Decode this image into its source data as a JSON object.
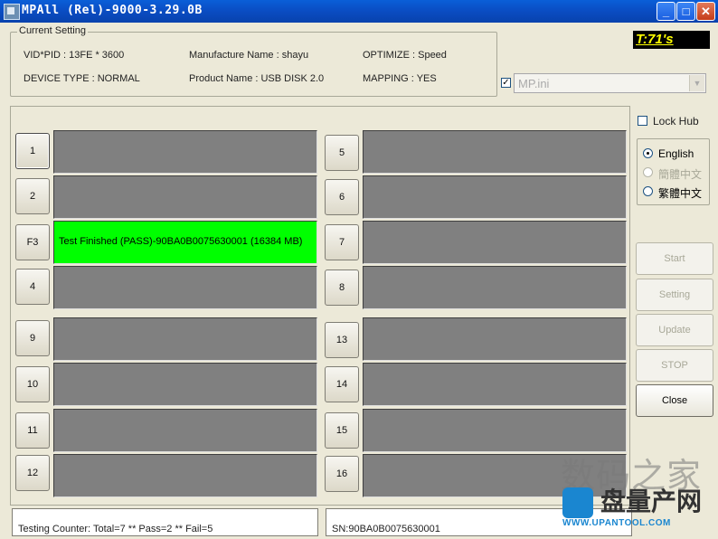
{
  "window": {
    "title": "MPAll (Rel)-9000-3.29.0B",
    "min_glyph": "_",
    "max_glyph": "□",
    "close_glyph": "✕"
  },
  "current_setting": {
    "legend": "Current Setting",
    "vid_pid": "VID*PID : 13FE * 3600",
    "device_type": "DEVICE TYPE : NORMAL",
    "manufacture_name": "Manufacture Name : shayu",
    "product_name": "Product Name : USB DISK 2.0",
    "optimize": "OPTIMIZE : Speed",
    "mapping": "MAPPING : YES"
  },
  "timer": "T:71's",
  "ini": {
    "checked_glyph": "✓",
    "value": "MP.ini",
    "arrow": "▼"
  },
  "lock_hub": {
    "label": "Lock Hub"
  },
  "language": {
    "options": [
      {
        "label": "English",
        "selected": true,
        "enabled": true
      },
      {
        "label": "簡體中文",
        "selected": false,
        "enabled": false
      },
      {
        "label": "繁體中文",
        "selected": false,
        "enabled": true
      }
    ]
  },
  "ports": [
    {
      "label": "1",
      "status": ""
    },
    {
      "label": "2",
      "status": ""
    },
    {
      "label": "F3",
      "status": "Test Finished (PASS)-90BA0B0075630001 (16384 MB)"
    },
    {
      "label": "4",
      "status": ""
    },
    {
      "label": "5",
      "status": ""
    },
    {
      "label": "6",
      "status": ""
    },
    {
      "label": "7",
      "status": ""
    },
    {
      "label": "8",
      "status": ""
    },
    {
      "label": "9",
      "status": ""
    },
    {
      "label": "10",
      "status": ""
    },
    {
      "label": "11",
      "status": ""
    },
    {
      "label": "12",
      "status": ""
    },
    {
      "label": "13",
      "status": ""
    },
    {
      "label": "14",
      "status": ""
    },
    {
      "label": "15",
      "status": ""
    },
    {
      "label": "16",
      "status": ""
    }
  ],
  "buttons": {
    "start": "Start",
    "setting": "Setting",
    "update": "Update",
    "stop": "STOP",
    "close": "Close"
  },
  "status_bar": {
    "counter": "Testing Counter: Total=7 ** Pass=2 ** Fail=5",
    "sn": "SN:90BA0B0075630001"
  },
  "watermark": {
    "line1": "数码之家",
    "line2": "盘量产网",
    "line3": "WWW.UPANTOOL.COM"
  },
  "colors": {
    "pass": "#00ff00",
    "idle_slot": "#808080",
    "title_bar": "#0a4cc2"
  }
}
